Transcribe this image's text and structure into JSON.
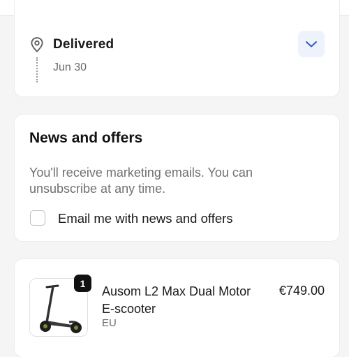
{
  "delivery": {
    "status": "Delivered",
    "date": "Jun 30",
    "icons": {
      "location": "map-pin-icon",
      "expand": "chevron-down-icon"
    },
    "accent_color": "#2c5cc5"
  },
  "news": {
    "title": "News and offers",
    "description": "You'll receive marketing emails. You can unsubscribe at any time.",
    "checkbox_label": "Email me with news and offers",
    "checkbox_checked": false
  },
  "order": {
    "items": [
      {
        "quantity": "1",
        "name": "Ausom L2 Max Dual Motor E-scooter",
        "variant": "EU",
        "price": "€749.00",
        "image": "e-scooter-image"
      }
    ]
  }
}
